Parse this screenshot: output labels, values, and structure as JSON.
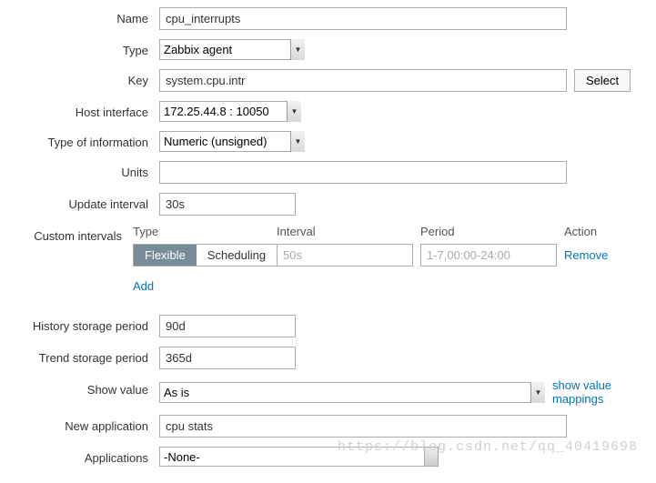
{
  "labels": {
    "name": "Name",
    "type": "Type",
    "key": "Key",
    "host_interface": "Host interface",
    "type_info": "Type of information",
    "units": "Units",
    "update_interval": "Update interval",
    "custom_intervals": "Custom intervals",
    "history": "History storage period",
    "trend": "Trend storage period",
    "show_value": "Show value",
    "new_app": "New application",
    "applications": "Applications"
  },
  "values": {
    "name": "cpu_interrupts",
    "type": "Zabbix agent",
    "key": "system.cpu.intr",
    "host_interface": "172.25.44.8 : 10050",
    "type_info": "Numeric (unsigned)",
    "units": "",
    "update_interval": "30s",
    "history": "90d",
    "trend": "365d",
    "show_value": "As is",
    "new_app": "cpu stats",
    "application_option": "-None-"
  },
  "buttons": {
    "select": "Select",
    "remove": "Remove",
    "add": "Add",
    "show_mappings": "show value mappings"
  },
  "intervals": {
    "header_type": "Type",
    "header_interval": "Interval",
    "header_period": "Period",
    "header_action": "Action",
    "toggle_flexible": "Flexible",
    "toggle_scheduling": "Scheduling",
    "placeholder_interval": "50s",
    "placeholder_period": "1-7,00:00-24:00"
  },
  "watermark": "https://blog.csdn.net/qq_40419698"
}
